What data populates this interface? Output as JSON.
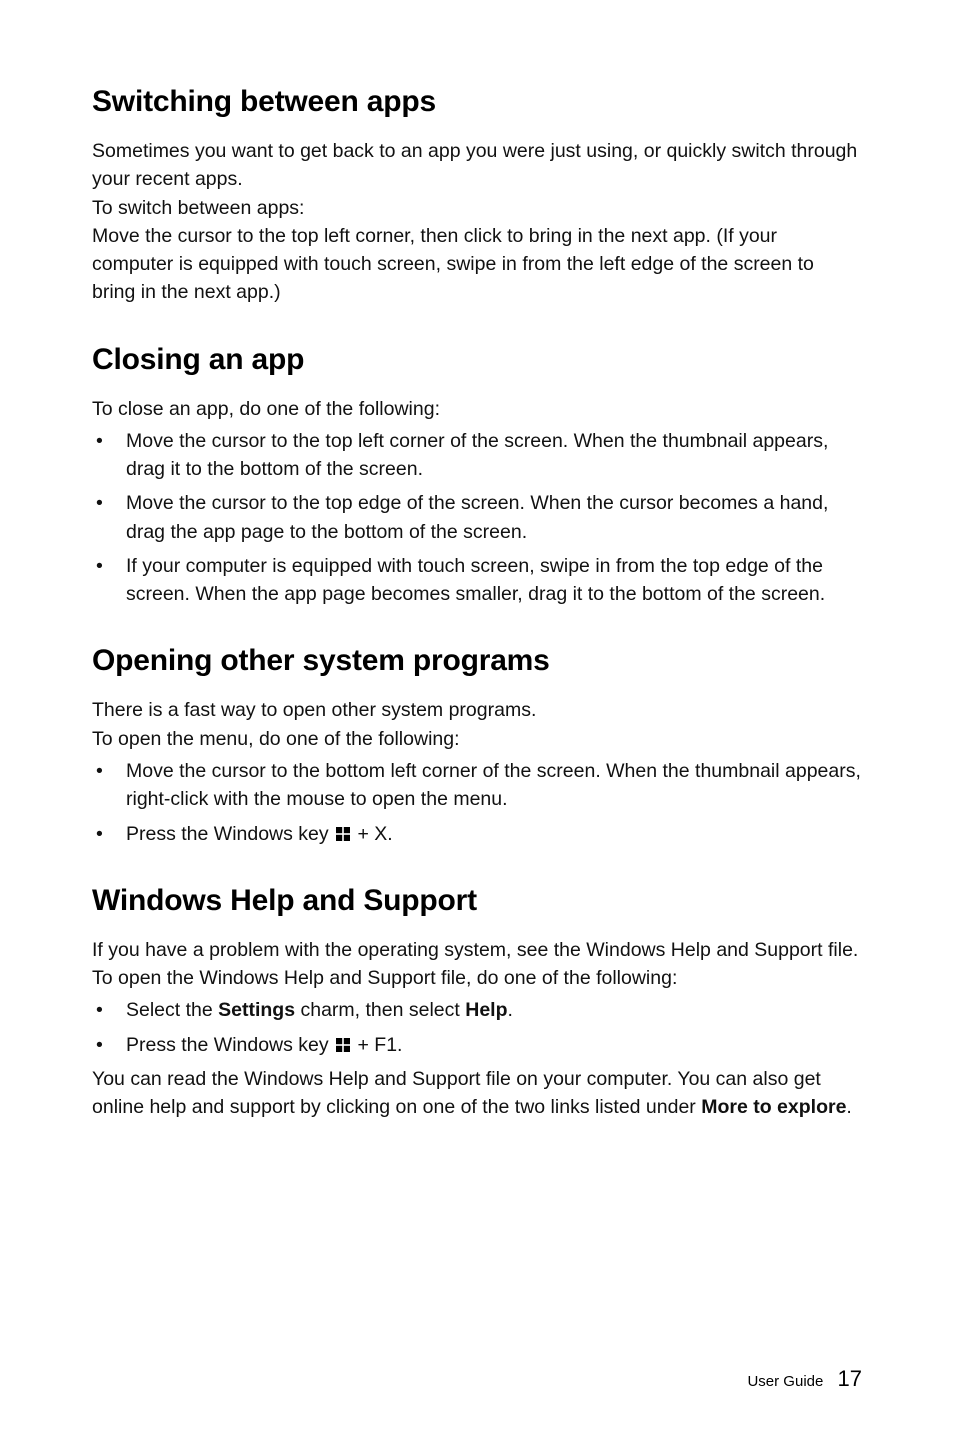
{
  "sections": {
    "switching": {
      "heading": "Switching between apps",
      "p1": "Sometimes you want to get back to an app you were just using, or quickly switch through your recent apps.",
      "p2": "To switch between apps:",
      "p3": "Move the cursor to the top left corner, then click to bring in the next app. (If your computer is equipped with touch screen, swipe in from the left edge of the screen to bring in the next app.)"
    },
    "closing": {
      "heading": "Closing an app",
      "intro": "To close an app, do one of the following:",
      "bullets": [
        "Move the cursor to the top left corner of the screen. When the thumbnail appears, drag it to the bottom of the screen.",
        "Move the cursor to the top edge of the screen. When the cursor becomes a hand, drag the app page to the bottom of the screen.",
        "If your computer is equipped with touch screen, swipe in from the top edge of the screen. When the app page becomes smaller, drag it to the bottom of the screen."
      ]
    },
    "opening": {
      "heading": "Opening other system programs",
      "p1": "There is a fast way to open other system programs.",
      "p2": "To open the menu, do one of the following:",
      "bullet1": "Move the cursor to the bottom left corner of the screen. When the thumbnail appears, right-click with the mouse to open the menu.",
      "bullet2_pre": "Press the Windows key ",
      "bullet2_post": " + X."
    },
    "help": {
      "heading": "Windows Help and Support",
      "p1": "If you have a problem with the operating system, see the Windows Help and Support file. To open the Windows Help and Support file, do one of the following:",
      "bullet1_pre": "Select the ",
      "bullet1_bold1": "Settings",
      "bullet1_mid": " charm, then select ",
      "bullet1_bold2": "Help",
      "bullet1_post": ".",
      "bullet2_pre": "Press the Windows key ",
      "bullet2_post": " + F1.",
      "p2_pre": "You can read the Windows Help and Support file on your computer. You can also get online help and support by clicking on one of the two links listed under ",
      "p2_bold": "More to explore",
      "p2_post": "."
    }
  },
  "footer": {
    "label": "User Guide",
    "page": "17"
  }
}
